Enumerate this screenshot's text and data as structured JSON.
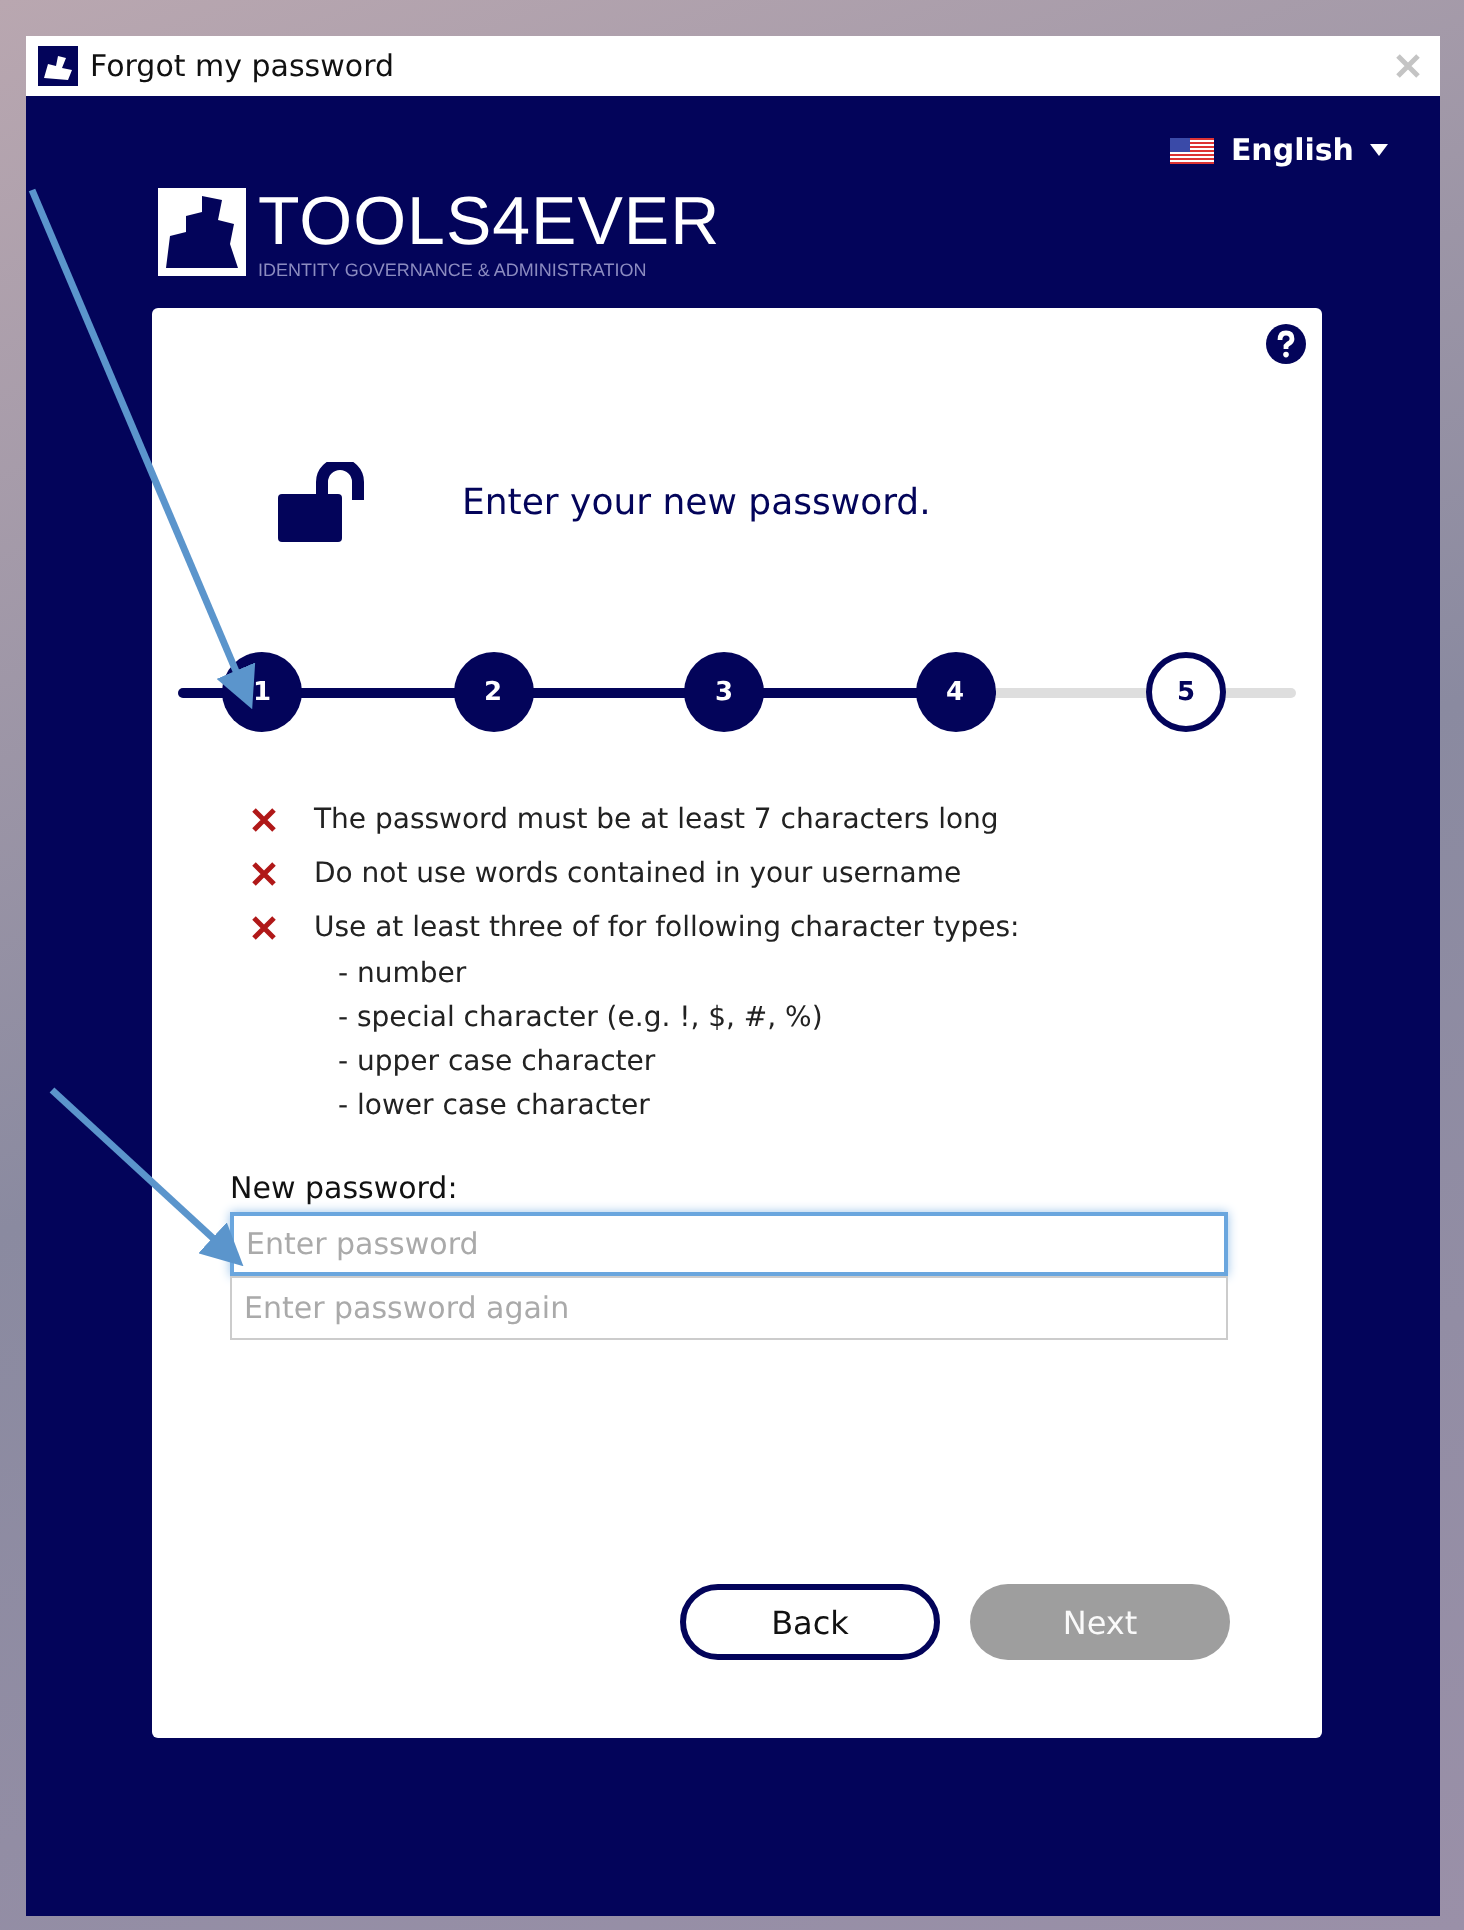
{
  "window": {
    "title": "Forgot my password"
  },
  "language": {
    "label": "English"
  },
  "logo": {
    "name": "TOOLS4EVER",
    "tagline": "IDENTITY GOVERNANCE & ADMINISTRATION"
  },
  "heading": "Enter your new password.",
  "steps": [
    {
      "label": "1",
      "completed": true
    },
    {
      "label": "2",
      "completed": true
    },
    {
      "label": "3",
      "completed": true
    },
    {
      "label": "4",
      "completed": true
    },
    {
      "label": "5",
      "completed": false
    }
  ],
  "rules": [
    {
      "text": "The password must be at least 7 characters long",
      "met": false
    },
    {
      "text": "Do not use words contained in your username",
      "met": false
    },
    {
      "text": "Use at least three of for following character types:",
      "met": false
    }
  ],
  "character_types": [
    "- number",
    "- special character (e.g. !, $, #, %)",
    "- upper case character",
    "- lower case character"
  ],
  "form": {
    "label": "New password:",
    "fields": [
      {
        "placeholder": "Enter password",
        "focused": true
      },
      {
        "placeholder": "Enter password again",
        "focused": false
      }
    ]
  },
  "buttons": [
    {
      "label": "Back",
      "disabled": false
    },
    {
      "label": "Next",
      "disabled": true
    }
  ]
}
